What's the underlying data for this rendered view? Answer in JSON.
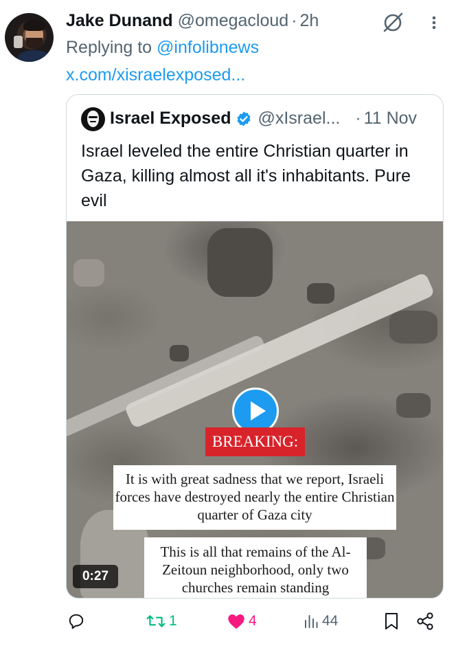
{
  "tweet": {
    "author_name": "Jake Dunand",
    "author_handle": "@omegacloud",
    "separator": "·",
    "time": "2h",
    "replying_prefix": "Replying to ",
    "replying_to": "@infolibnews",
    "link_text": "x.com/xisraelexposed..."
  },
  "quote": {
    "author_name": "Israel Exposed",
    "author_handle": "@xIsrael...",
    "separator": "·",
    "time": "11 Nov",
    "text": "Israel leveled the entire Christian quarter in Gaza, killing almost all it's inhabitants. Pure evil",
    "video": {
      "breaking_label": "BREAKING:",
      "caption_1": "It is with great sadness that we report, Israeli forces have destroyed nearly the entire Christian quarter of Gaza city",
      "caption_2": "This is all that remains of the Al-Zeitoun neighborhood, only two churches remain standing",
      "duration": "0:27"
    }
  },
  "actions": {
    "reply_count": "",
    "retweet_count": "1",
    "like_count": "4",
    "views_count": "44"
  },
  "icons": [
    "grok-icon",
    "more-icon",
    "verified-icon",
    "play-icon",
    "reply-icon",
    "retweet-icon",
    "like-icon",
    "views-icon",
    "bookmark-icon",
    "share-icon"
  ],
  "colors": {
    "accent": "#1d9bf0",
    "secondary_text": "#536471",
    "retweet_active": "#00ba7c",
    "like_active": "#f91880",
    "breaking_red": "#d8232a"
  }
}
